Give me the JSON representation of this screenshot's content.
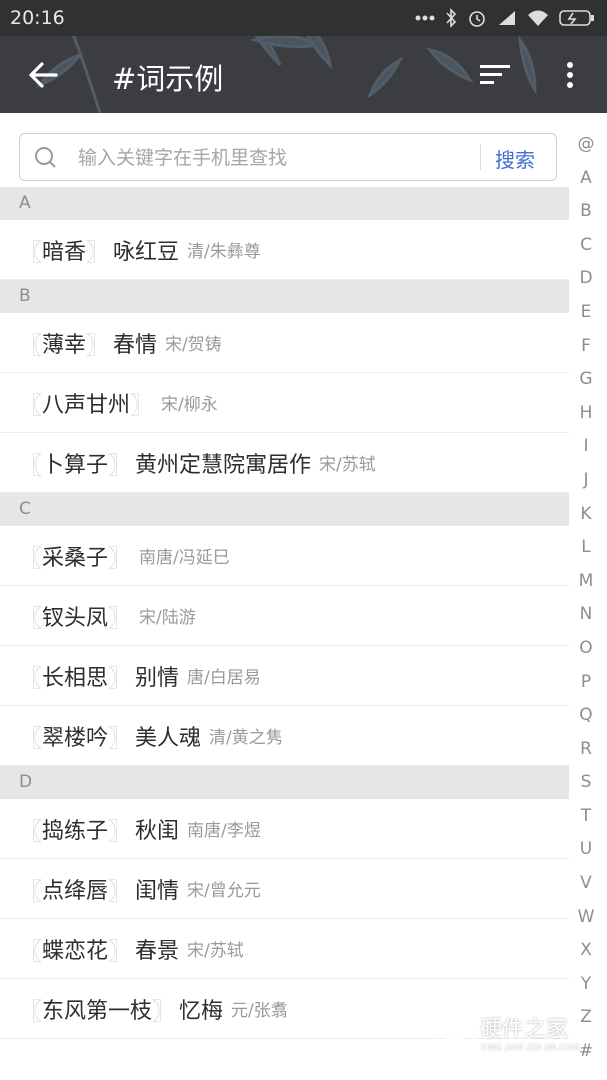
{
  "status_bar": {
    "time": "20:16"
  },
  "toolbar": {
    "title": "#词示例"
  },
  "search": {
    "placeholder": "输入关键字在手机里查找",
    "button": "搜索"
  },
  "sections": [
    {
      "letter": "A",
      "items": [
        {
          "title": "暗香",
          "subtitle": "咏红豆",
          "author": "清/朱彝尊"
        }
      ]
    },
    {
      "letter": "B",
      "items": [
        {
          "title": "薄幸",
          "subtitle": "春情",
          "author": "宋/贺铸"
        },
        {
          "title": "八声甘州",
          "subtitle": "",
          "author": "宋/柳永"
        },
        {
          "title": "卜算子",
          "subtitle": "黄州定慧院寓居作",
          "author": "宋/苏轼"
        }
      ]
    },
    {
      "letter": "C",
      "items": [
        {
          "title": "采桑子",
          "subtitle": "",
          "author": "南唐/冯延巳"
        },
        {
          "title": "钗头凤",
          "subtitle": "",
          "author": "宋/陆游"
        },
        {
          "title": "长相思",
          "subtitle": "别情",
          "author": "唐/白居易"
        },
        {
          "title": "翠楼吟",
          "subtitle": "美人魂",
          "author": "清/黄之隽"
        }
      ]
    },
    {
      "letter": "D",
      "items": [
        {
          "title": "捣练子",
          "subtitle": "秋闺",
          "author": "南唐/李煜"
        },
        {
          "title": "点绛唇",
          "subtitle": "闺情",
          "author": "宋/曾允元"
        },
        {
          "title": "蝶恋花",
          "subtitle": "春景",
          "author": "宋/苏轼"
        },
        {
          "title": "东风第一枝",
          "subtitle": "忆梅",
          "author": "元/张翥"
        }
      ]
    }
  ],
  "index_letters": [
    "@",
    "A",
    "B",
    "C",
    "D",
    "E",
    "F",
    "G",
    "H",
    "I",
    "J",
    "K",
    "L",
    "M",
    "N",
    "O",
    "P",
    "Q",
    "R",
    "S",
    "T",
    "U",
    "V",
    "W",
    "X",
    "Y",
    "Z",
    "#"
  ],
  "watermark": {
    "name": "硬件之家",
    "sub": "YING JIAN ZHI JIA.COM"
  },
  "colors": {
    "header_bg": "#3b3d40",
    "accent": "#3f6fd1",
    "section_bg": "#e6e6e8"
  }
}
